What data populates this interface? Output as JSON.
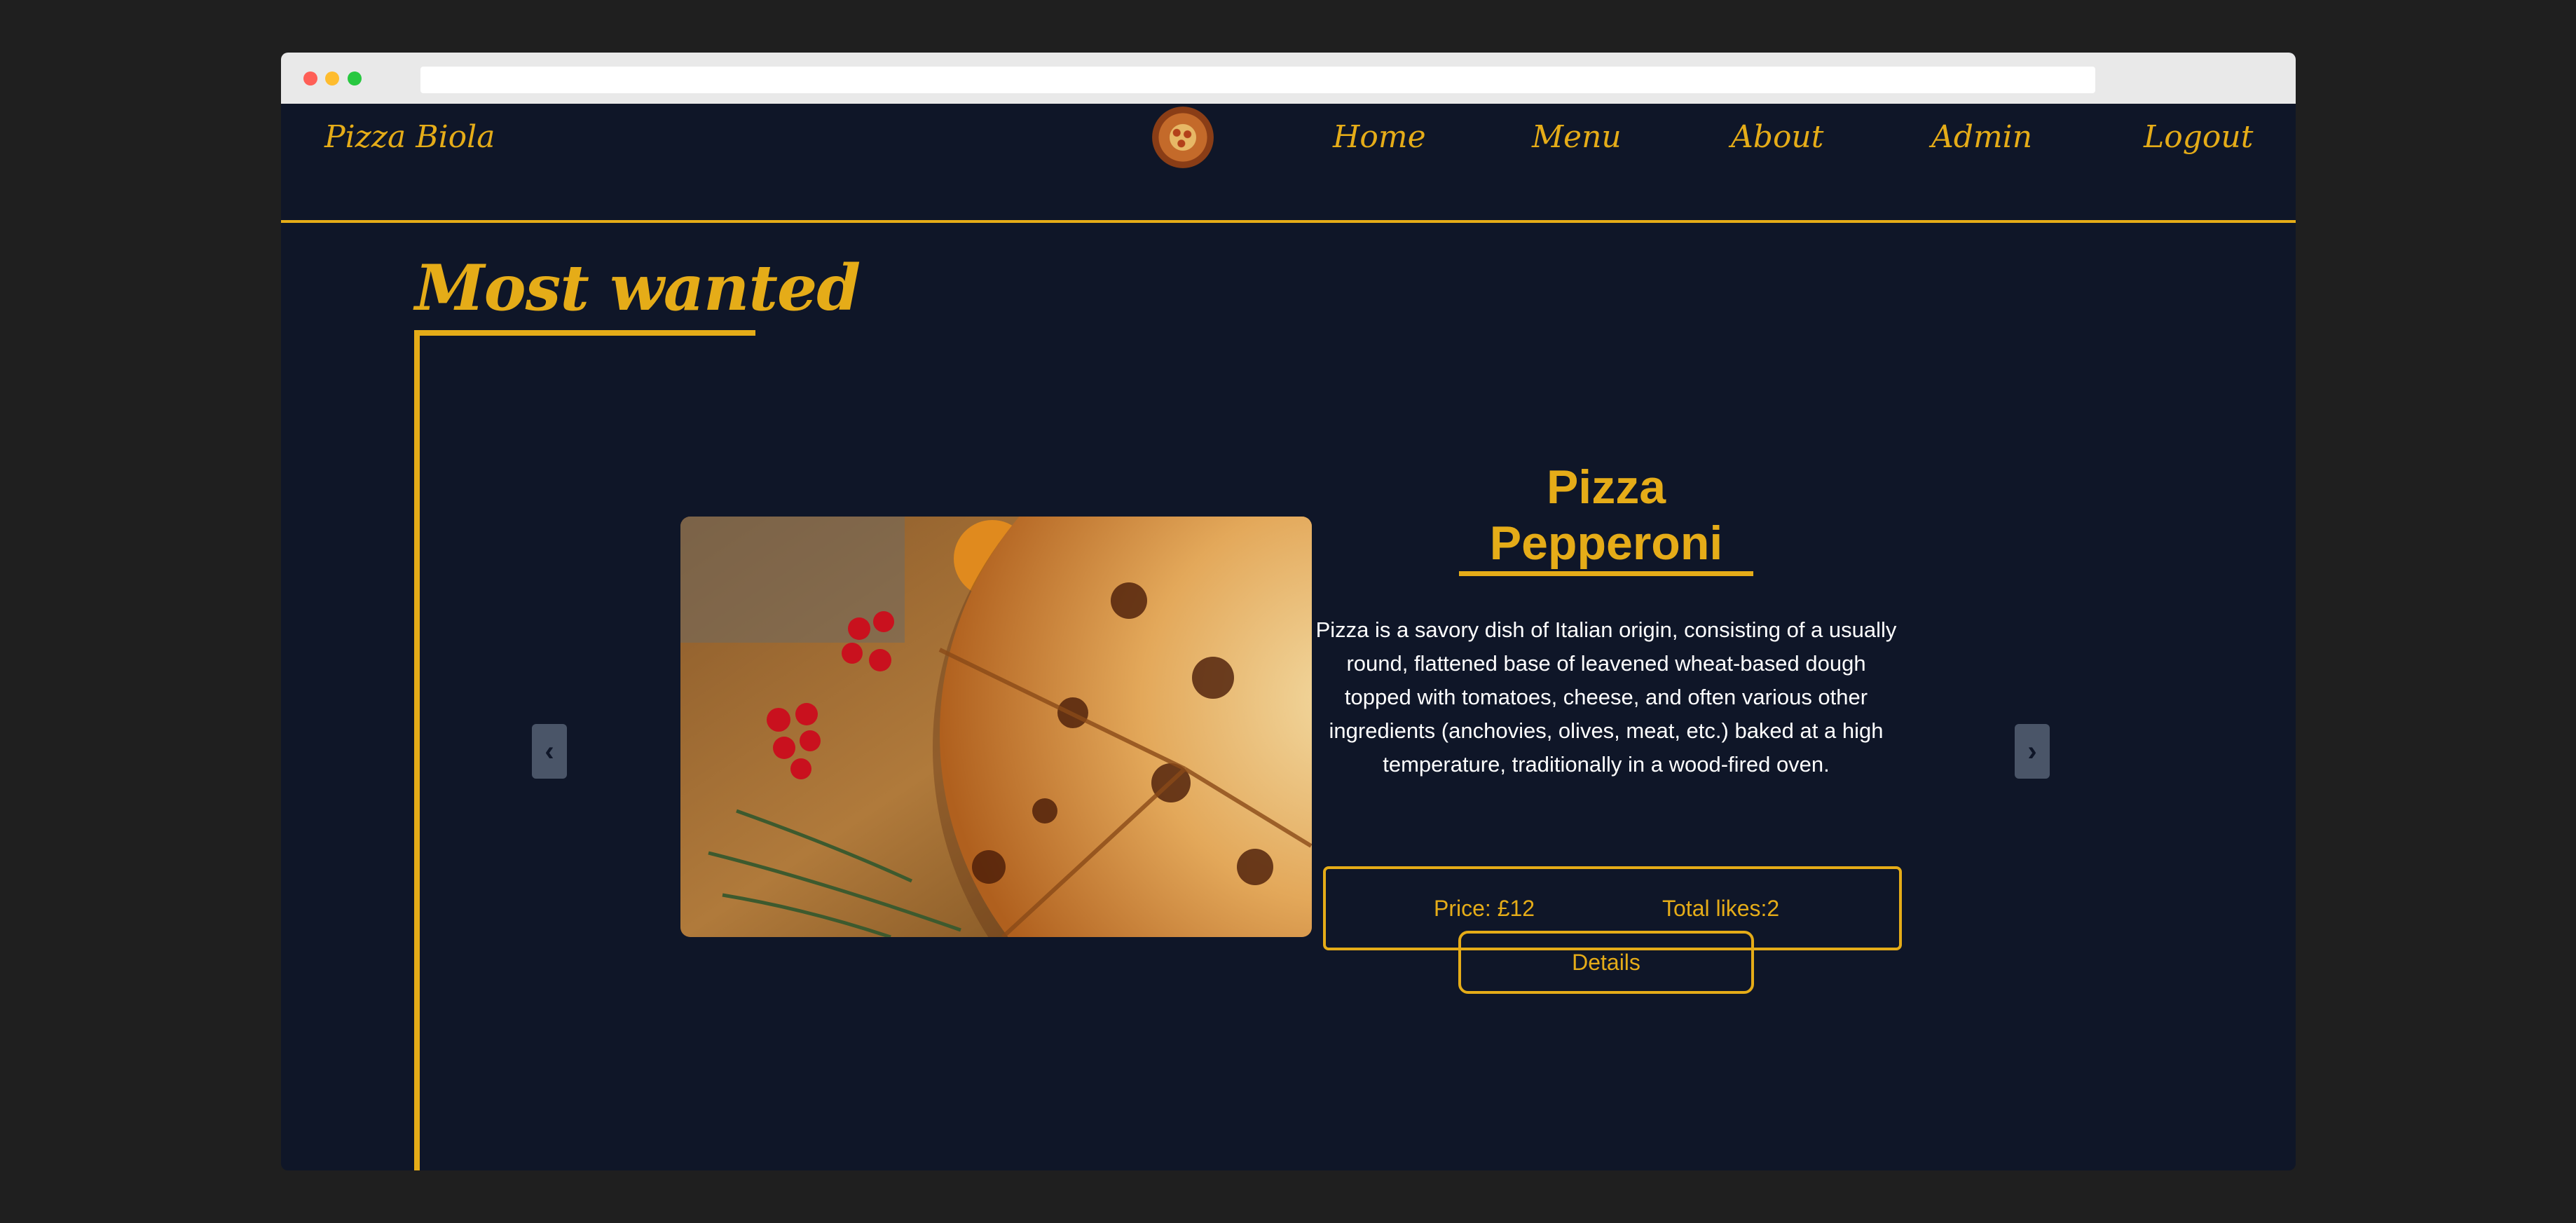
{
  "browser": {
    "address": ""
  },
  "nav": {
    "brand": "Pizza Biola",
    "links": [
      "Home",
      "Menu",
      "About",
      "Admin",
      "Logout"
    ]
  },
  "section": {
    "title": "Most wanted"
  },
  "carousel": {
    "prev_label": "‹",
    "next_label": "›"
  },
  "product": {
    "name": "Pizza Pepperoni",
    "description": "Pizza is a savory dish of Italian origin, consisting of a usually round, flattened base of leavened wheat-based dough topped with tomatoes, cheese, and often various other ingredients (anchovies, olives, meat, etc.) baked at a high temperature, traditionally in a wood-fired oven.",
    "price": "Price: £12",
    "likes": "Total likes:2",
    "details_label": "Details"
  },
  "colors": {
    "background": "#0f1628",
    "accent": "#e5ac18",
    "button_gray": "#4a5568"
  },
  "icons": {
    "logo": "pizza-logo-icon",
    "prev": "chevron-left-icon",
    "next": "chevron-right-icon"
  }
}
